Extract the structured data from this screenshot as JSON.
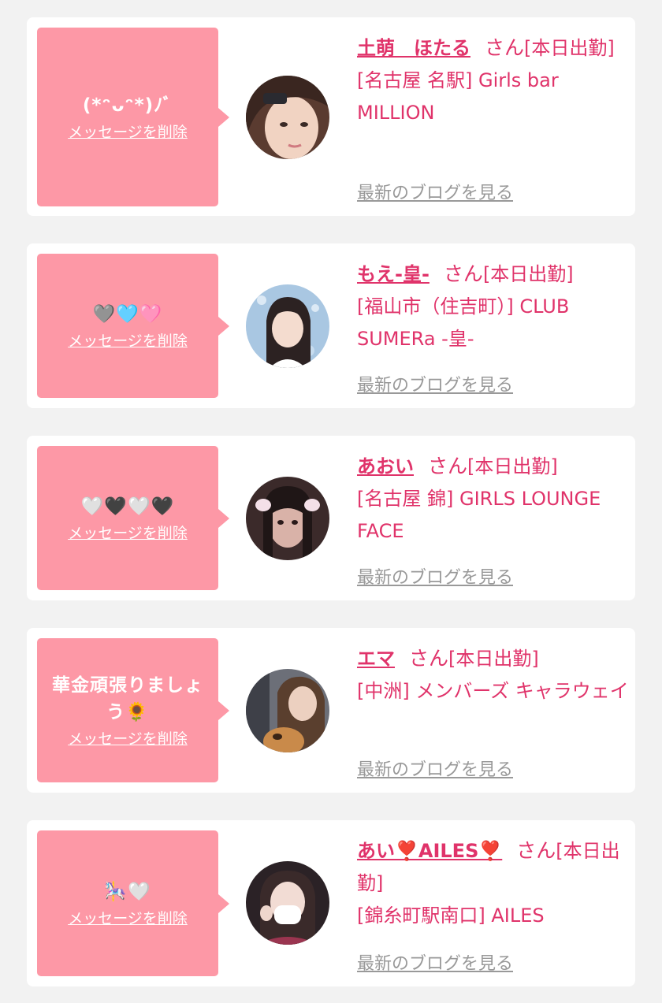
{
  "delete_label": "メッセージを削除",
  "blog_label": "最新のブログを見る",
  "honorific": "さん",
  "colors": {
    "bubble": "#fd98a6",
    "accent": "#e0336a",
    "muted": "#999999",
    "card": "#ffffff",
    "background": "#f2f2f2"
  },
  "cards": [
    {
      "message": "(*ᵔᴗᵔ*)ﾉﾞ",
      "name": "土萌　ほたる",
      "status": "[本日出勤]",
      "shop": "[名古屋 名駅] Girls bar MILLION"
    },
    {
      "message": "🩶🩵🩷",
      "name": "もえ-皇-",
      "status": "[本日出勤]",
      "shop": "[福山市（住吉町）] CLUB SUMERa -皇-"
    },
    {
      "message": "🤍🖤🤍🖤",
      "name": "あおい",
      "status": "[本日出勤]",
      "shop": "[名古屋 錦] GIRLS LOUNGE FACE"
    },
    {
      "message": "華金頑張りましょう🌻",
      "name": "エマ",
      "status": "[本日出勤]",
      "shop": "[中洲] メンバーズ キャラウェイ"
    },
    {
      "message": "🎠🤍",
      "name": "あい❣️AILES❣️",
      "status": "[本日出勤]",
      "shop": "[錦糸町駅南口] AILES"
    }
  ]
}
